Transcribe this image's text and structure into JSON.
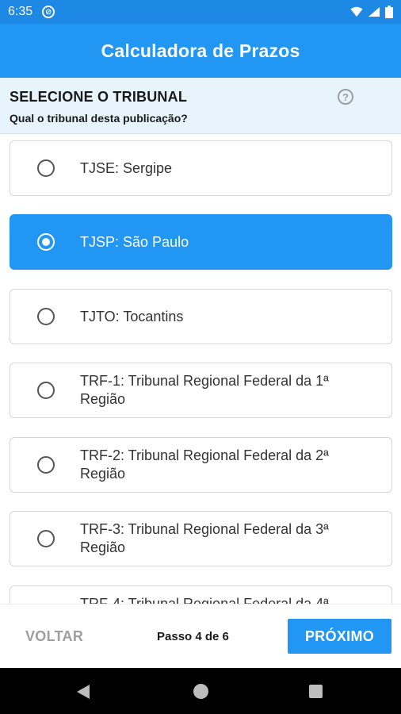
{
  "status_bar": {
    "time": "6:35",
    "icons": [
      "data-saver-icon",
      "wifi-icon",
      "signal-icon",
      "battery-icon"
    ]
  },
  "app_bar": {
    "title": "Calculadora de Prazos"
  },
  "section": {
    "title": "SELECIONE O TRIBUNAL",
    "subtitle": "Qual o tribunal desta publicação?",
    "help_icon": "help-icon",
    "help_glyph": "?"
  },
  "options": [
    {
      "label": "TJSE: Sergipe",
      "selected": false
    },
    {
      "label": "TJSP: São Paulo",
      "selected": true
    },
    {
      "label": "TJTO: Tocantins",
      "selected": false
    },
    {
      "label": "TRF-1: Tribunal Regional Federal da 1ª Região",
      "selected": false
    },
    {
      "label": "TRF-2: Tribunal Regional Federal da 2ª Região",
      "selected": false
    },
    {
      "label": "TRF-3: Tribunal Regional Federal da 3ª Região",
      "selected": false
    },
    {
      "label": "TRF-4: Tribunal Regional Federal da 4ª",
      "selected": false
    }
  ],
  "footer": {
    "back_label": "VOLTAR",
    "step_text": "Passo 4 de 6",
    "next_label": "PRÓXIMO"
  },
  "colors": {
    "status_bar": "#1e88e5",
    "primary": "#2196f3",
    "header_bg": "#e8f4fc",
    "disabled_text": "#9e9e9e"
  }
}
